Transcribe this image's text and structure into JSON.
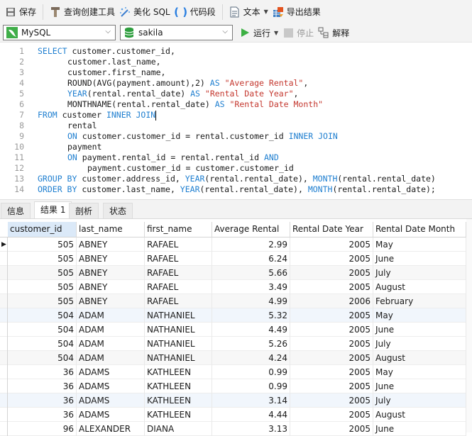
{
  "toolbar": {
    "save": "保存",
    "query_builder": "查询创建工具",
    "beautify_sql": "美化 SQL",
    "code_snippet": "代码段",
    "text": "文本",
    "export_result": "导出结果",
    "run": "运行",
    "stop": "停止",
    "explain": "解释"
  },
  "connection": {
    "selected": "MySQL"
  },
  "database": {
    "selected": "sakila"
  },
  "editor": {
    "lines": [
      {
        "n": "1"
      },
      {
        "n": "2"
      },
      {
        "n": "3"
      },
      {
        "n": "4"
      },
      {
        "n": "5"
      },
      {
        "n": "6"
      },
      {
        "n": "7"
      },
      {
        "n": "8"
      },
      {
        "n": "9"
      },
      {
        "n": "10"
      },
      {
        "n": "11"
      },
      {
        "n": "12"
      },
      {
        "n": "13"
      },
      {
        "n": "14"
      }
    ],
    "sql": {
      "l1_kw": "SELECT",
      "l1": " customer.customer_id,",
      "l2": "customer.last_name,",
      "l3": "customer.first_name,",
      "l4_a": "ROUND(AVG(payment.amount),2) ",
      "l4_kw": "AS",
      "l4_str": " \"Average Rental\"",
      "l4_end": ",",
      "l5_fn": "YEAR",
      "l5_a": "(rental.rental_date) ",
      "l5_kw": "AS",
      "l5_str": " \"Rental Date Year\"",
      "l5_end": ",",
      "l6_a": "MONTHNAME(rental.rental_date) ",
      "l6_kw": "AS",
      "l6_str": " \"Rental Date Month\"",
      "l7_kw1": "FROM",
      "l7_a": " customer ",
      "l7_kw2": "INNER JOIN",
      "l8": "rental",
      "l9_kw1": "ON",
      "l9_a": " customer.customer_id = rental.customer_id ",
      "l9_kw2": "INNER JOIN",
      "l10": "payment",
      "l11_kw1": "ON",
      "l11_a": " payment.rental_id = rental.rental_id ",
      "l11_kw2": "AND",
      "l12": "payment.customer_id = customer.customer_id",
      "l13_kw": "GROUP BY",
      "l13_a": " customer.address_id, ",
      "l13_fn1": "YEAR",
      "l13_b": "(rental.rental_date), ",
      "l13_fn2": "MONTH",
      "l13_c": "(rental.rental_date)",
      "l14_kw": "ORDER BY",
      "l14_a": " customer.last_name, ",
      "l14_fn1": "YEAR",
      "l14_b": "(rental.rental_date), ",
      "l14_fn2": "MONTH",
      "l14_c": "(rental.rental_date);"
    }
  },
  "result_tabs": [
    "信息",
    "结果 1",
    "剖析",
    "状态"
  ],
  "active_tab": "结果 1",
  "grid": {
    "columns": [
      "customer_id",
      "last_name",
      "first_name",
      "Average Rental",
      "Rental Date Year",
      "Rental Date Month"
    ],
    "rows": [
      [
        "505",
        "ABNEY",
        "RAFAEL",
        "2.99",
        "2005",
        "May"
      ],
      [
        "505",
        "ABNEY",
        "RAFAEL",
        "6.24",
        "2005",
        "June"
      ],
      [
        "505",
        "ABNEY",
        "RAFAEL",
        "5.66",
        "2005",
        "July"
      ],
      [
        "505",
        "ABNEY",
        "RAFAEL",
        "3.49",
        "2005",
        "August"
      ],
      [
        "505",
        "ABNEY",
        "RAFAEL",
        "4.99",
        "2006",
        "February"
      ],
      [
        "504",
        "ADAM",
        "NATHANIEL",
        "5.32",
        "2005",
        "May"
      ],
      [
        "504",
        "ADAM",
        "NATHANIEL",
        "4.49",
        "2005",
        "June"
      ],
      [
        "504",
        "ADAM",
        "NATHANIEL",
        "5.26",
        "2005",
        "July"
      ],
      [
        "504",
        "ADAM",
        "NATHANIEL",
        "4.24",
        "2005",
        "August"
      ],
      [
        "36",
        "ADAMS",
        "KATHLEEN",
        "0.99",
        "2005",
        "May"
      ],
      [
        "36",
        "ADAMS",
        "KATHLEEN",
        "0.99",
        "2005",
        "June"
      ],
      [
        "36",
        "ADAMS",
        "KATHLEEN",
        "3.14",
        "2005",
        "July"
      ],
      [
        "36",
        "ADAMS",
        "KATHLEEN",
        "4.44",
        "2005",
        "August"
      ],
      [
        "96",
        "ALEXANDER",
        "DIANA",
        "3.13",
        "2005",
        "June"
      ]
    ]
  },
  "colors": {
    "keyword": "#1f7fd0",
    "string": "#c4372e",
    "run_green": "#3cb043",
    "db_green": "#2e9e3e"
  }
}
